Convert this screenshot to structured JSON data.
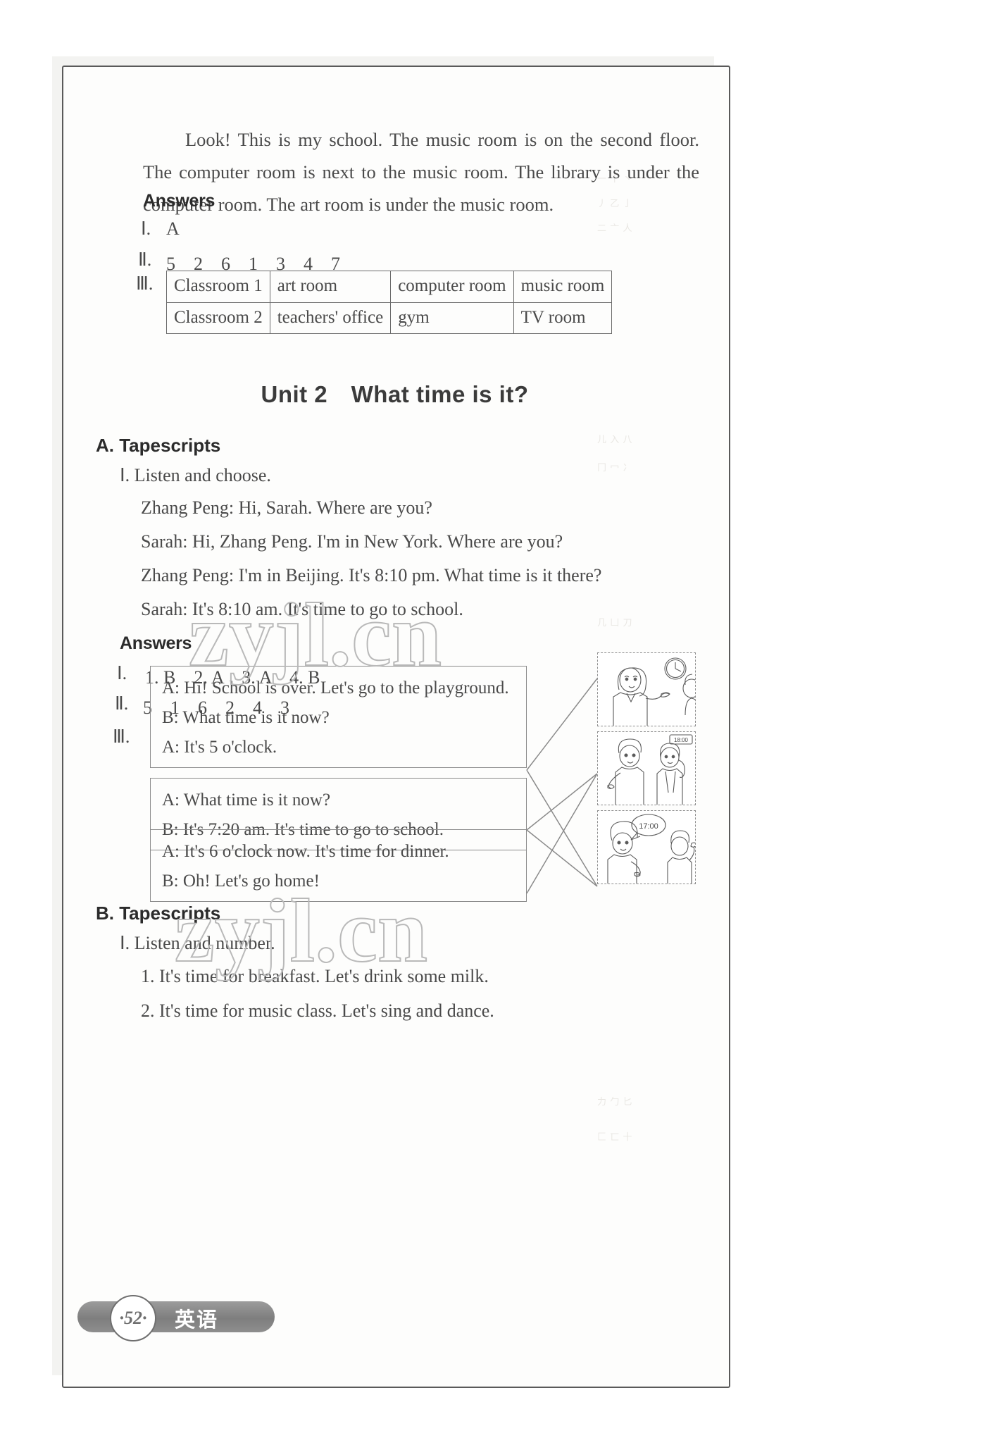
{
  "page": {
    "number": "·52·",
    "subject": "英语",
    "watermark": "zyjl.cn"
  },
  "intro": {
    "text": "Look! This is my school. The music room is on the second floor. The computer room is next to the music room. The library is under the computer room. The art room is under the music room."
  },
  "unit1_answers": {
    "heading": "Answers",
    "item1_label": "Ⅰ.",
    "item1_value": "A",
    "item2_label": "Ⅱ.",
    "item2_value": "5　2　6　1　3　4　7",
    "item3_label": "Ⅲ.",
    "table": {
      "rows": [
        [
          "Classroom 1",
          "art room",
          "computer room",
          "music room"
        ],
        [
          "Classroom 2",
          "teachers' office",
          "gym",
          "TV room"
        ]
      ]
    }
  },
  "unit2": {
    "title": "Unit 2　What time is it?",
    "section_a": {
      "heading": "A. Tapescripts",
      "part1_label": "Ⅰ. Listen and choose.",
      "dialogue": [
        "Zhang Peng: Hi, Sarah. Where are you?",
        "Sarah: Hi, Zhang Peng. I'm in New York. Where are you?",
        "Zhang Peng: I'm in Beijing. It's 8:10 pm. What time is it there?",
        "Sarah: It's 8:10 am. It's time to go to school."
      ],
      "answers_heading": "Answers",
      "answer1_label": "Ⅰ.",
      "answer1_value": "1. B　2. A　3. A　4. B",
      "answer2_label": "Ⅱ.",
      "answer2_value": "5　1　6　2　4　3",
      "answer3_label": "Ⅲ.",
      "match_boxes": [
        {
          "lines": [
            "A: Hi! School is over. Let's go to the playground.",
            "B: What time is it now?",
            "A: It's 5 o'clock."
          ]
        },
        {
          "lines": [
            "A: What time is it now?",
            "B: It's 7:20 am. It's time to go to school."
          ]
        },
        {
          "lines": [
            "A: It's  6 o'clock now. It's time for dinner.",
            "B: Oh! Let's go home!"
          ]
        }
      ],
      "pictures": [
        {
          "name": "teacher-pointing-at-clock",
          "clock_label": ""
        },
        {
          "name": "two-students-talking",
          "clock_label": "18:00"
        },
        {
          "name": "boy-with-speech-bubble",
          "clock_label": "17:00"
        }
      ]
    },
    "section_b": {
      "heading": "B. Tapescripts",
      "part1_label": "Ⅰ. Listen and number.",
      "items": [
        "1. It's time for breakfast. Let's drink some milk.",
        "2. It's time for music class. Let's sing and dance."
      ]
    }
  },
  "ghost_marks": [
    "当 ⼀",
    "⼋ ⼁",
    "⼗ ⼚",
    "⼌ ⼍",
    "⼃ ⼄",
    "⼀ ⼆",
    "⼝ ⼞",
    "⼡ ⼢",
    "⼣ ⼤",
    "⼥ ⼦"
  ]
}
